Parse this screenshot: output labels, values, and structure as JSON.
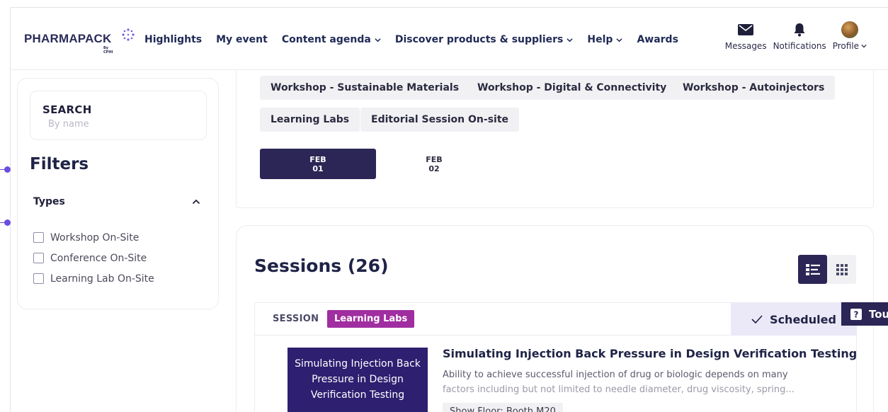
{
  "brand": {
    "name": "PHARMAPACK",
    "sub": "By CPHI",
    "accent": "#2b2656",
    "star_color": "#7b5ce6"
  },
  "nav": {
    "items": [
      {
        "label": "Highlights",
        "dropdown": false
      },
      {
        "label": "My event",
        "dropdown": false
      },
      {
        "label": "Content agenda",
        "dropdown": true
      },
      {
        "label": "Discover products & suppliers",
        "dropdown": true
      },
      {
        "label": "Help",
        "dropdown": true
      },
      {
        "label": "Awards",
        "dropdown": false
      }
    ]
  },
  "utilities": {
    "messages": "Messages",
    "notifications": "Notifications",
    "profile": "Profile"
  },
  "sidebar": {
    "search_label": "SEARCH",
    "search_placeholder": "By name",
    "filters_title": "Filters",
    "types_label": "Types",
    "types": [
      "Workshop On-Site",
      "Conference On-Site",
      "Learning Lab On-Site"
    ]
  },
  "tags": {
    "row1": [
      "Workshop - Sustainable Materials",
      "Workshop - Digital & Connectivity",
      "Workshop - Autoinjectors"
    ],
    "row2": [
      "Learning Labs",
      "Editorial Session On-site"
    ]
  },
  "dates": [
    {
      "month": "FEB",
      "day": "01",
      "active": true
    },
    {
      "month": "FEB",
      "day": "02",
      "active": false
    }
  ],
  "sessions": {
    "title": "Sessions (26)",
    "card": {
      "kind": "SESSION",
      "badge": "Learning Labs",
      "badge_color": "#a02ea0",
      "scheduled": "Scheduled",
      "thumb_lines": [
        "Simulating Injection Back",
        "Pressure in Design",
        "Verification Testing"
      ],
      "title": "Simulating Injection Back Pressure in Design Verification Testing",
      "desc_line1": "Ability to achieve successful injection of drug or biologic depends on many",
      "desc_line2": "factors including but not limited to needle diameter, drug viscosity, spring...",
      "location": "Show Floor: Booth M20"
    }
  },
  "tour": {
    "label": "Tou"
  }
}
